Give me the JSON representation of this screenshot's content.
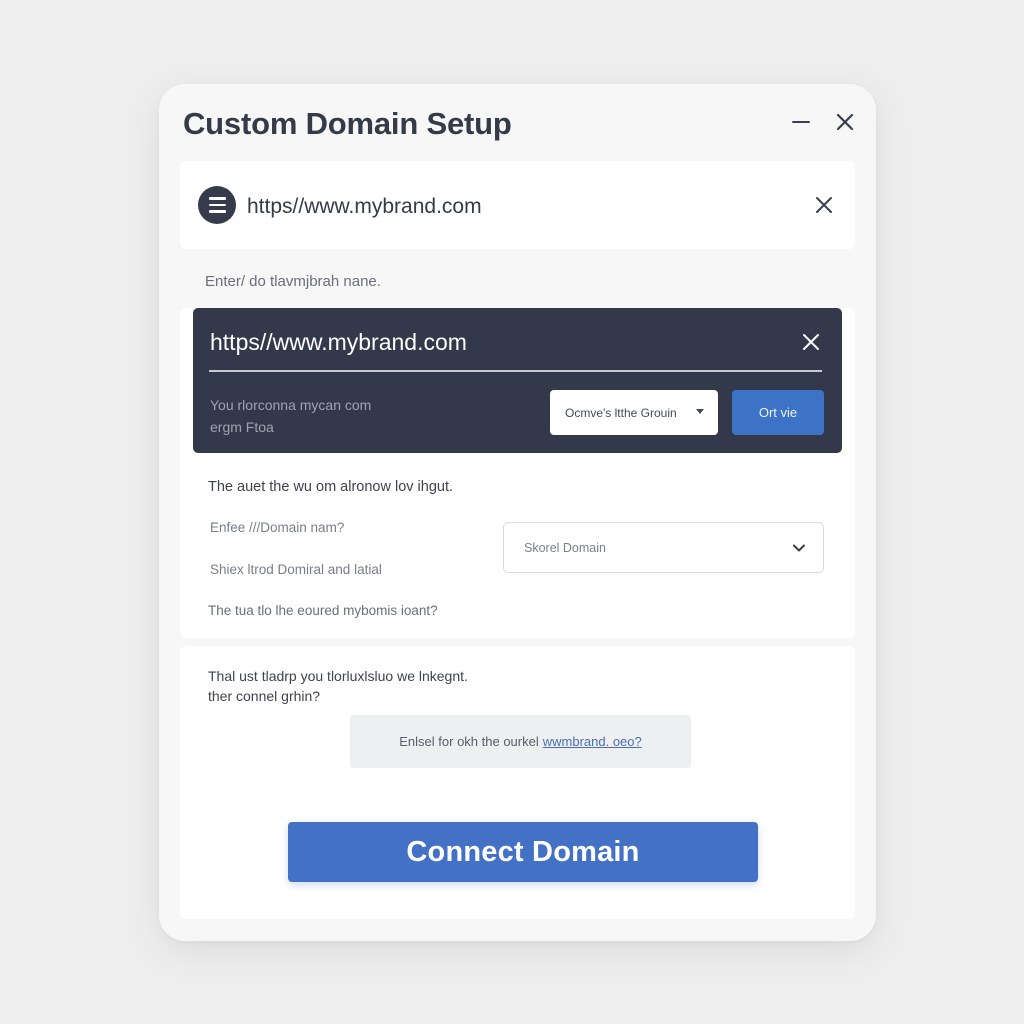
{
  "dialog": {
    "title": "Custom Domain Setup",
    "minimize_icon": "minimize-icon",
    "close_icon": "close-icon"
  },
  "url_bar": {
    "menu_icon": "menu-icon",
    "value": "https//www.mybrand.com",
    "clear_icon": "close-icon"
  },
  "hint": "Enter/ do tlavmjbrah nane.",
  "dark_panel": {
    "url_value": "https//www.mybrand.com",
    "clear_icon": "close-icon",
    "note_line1": "You rlorconna mycan com",
    "note_line2": "ergm Ftoa",
    "select_value": "Ocmve's ltthe Grouin",
    "button_label": "Ort vie"
  },
  "form": {
    "question": "The auet the wu om alronow lov ihgut.",
    "label_domain_name": "Enfee ///Domain nam?",
    "label_domain_detail": "Shiex ltrod Domiral and latial",
    "label_footer": "The tua tlo lhe eoured mybomis ioant?",
    "domain_select": {
      "value": "Skorel Domain",
      "chevron_icon": "chevron-down-icon"
    }
  },
  "bottom": {
    "text_line1": "Thal ust tladrp you tlorluxlsluo we lnkegnt.",
    "text_line2": "ther connel grhin?",
    "link_prefix": "Enlsel for okh the ourkel",
    "link_text": "wwmbrand. oeo?",
    "connect_label": "Connect Domain"
  },
  "colors": {
    "accent": "#4271c6",
    "dark_panel": "#33384b",
    "background": "#eeeeee"
  }
}
